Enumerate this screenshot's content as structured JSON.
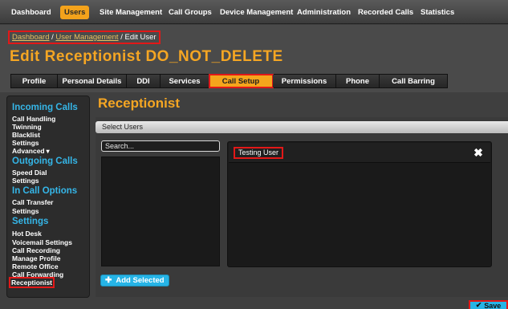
{
  "topnav": {
    "items": [
      {
        "label": "Dashboard"
      },
      {
        "label": "Users"
      },
      {
        "label": "Site Management"
      },
      {
        "label": "Call Groups"
      },
      {
        "label": "Device Management"
      },
      {
        "label": "Administration"
      },
      {
        "label": "Recorded Calls"
      },
      {
        "label": "Statistics"
      }
    ],
    "active": "Users"
  },
  "breadcrumb": {
    "dashboard": "Dashboard",
    "sep1": " / ",
    "user_management": "User Management",
    "sep2": " / ",
    "current": "Edit User"
  },
  "page_title": "Edit Receptionist DO_NOT_DELETE",
  "tabs": [
    {
      "label": "Profile"
    },
    {
      "label": "Personal Details"
    },
    {
      "label": "DDI"
    },
    {
      "label": "Services"
    },
    {
      "label": "Call Setup"
    },
    {
      "label": "Permissions"
    },
    {
      "label": "Phone"
    },
    {
      "label": "Call Barring"
    }
  ],
  "active_tab": "Call Setup",
  "sidebar": {
    "incoming": {
      "title": "Incoming Calls",
      "items": [
        "Call Handling",
        "Twinning",
        "Blacklist",
        "Settings",
        "Advanced"
      ]
    },
    "outgoing": {
      "title": "Outgoing Calls",
      "items": [
        "Speed Dial",
        "Settings"
      ]
    },
    "in_call": {
      "title": "In Call Options",
      "items": [
        "Call Transfer",
        "Settings"
      ]
    },
    "settings": {
      "title": "Settings",
      "items": [
        "Hot Desk",
        "Voicemail Settings",
        "Call Recording",
        "Manage Profile",
        "Remote Office",
        "Call Forwarding",
        "Receptionist"
      ]
    },
    "selected": "Receptionist"
  },
  "main": {
    "heading": "Receptionist",
    "panel_title": "Select Users",
    "search_placeholder": "Search...",
    "selected_users": [
      "Testing User"
    ],
    "add_button": "Add Selected",
    "save_button": "Save"
  },
  "colors": {
    "accent_orange": "#f5a623",
    "accent_blue": "#35b6e8",
    "button_blue": "#26b4e6",
    "highlight_red": "#e21818"
  },
  "icons": {
    "add": "plus-circle-icon",
    "remove": "close-icon",
    "save": "checkmark-icon",
    "advanced": "caret-down-icon"
  }
}
